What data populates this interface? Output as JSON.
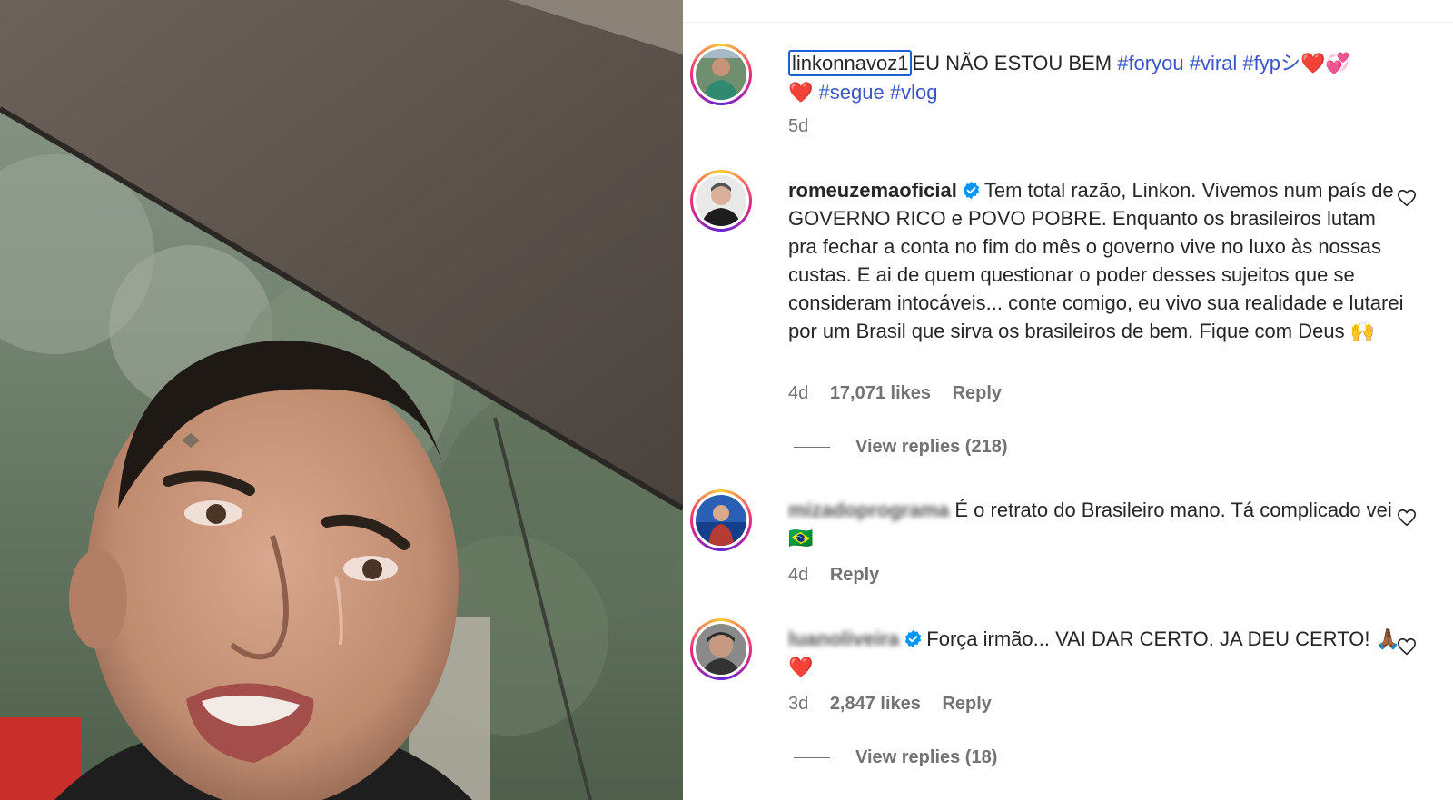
{
  "post": {
    "username": "linkonnavoz1",
    "caption": "EU NÃO ESTOU BEM",
    "hashtags_line1": [
      "#foryou",
      "#viral",
      "#fypシ"
    ],
    "emoji_line1": "❤️💞",
    "emoji_line2": "❤️",
    "hashtags_line2": [
      "#segue",
      "#vlog"
    ],
    "time": "5d"
  },
  "comments": [
    {
      "username": "romeuzemaoficial",
      "verified": true,
      "text": "Tem total razão, Linkon. Vivemos num país de GOVERNO RICO e POVO POBRE. Enquanto os brasileiros lutam pra fechar a conta no fim do mês o governo vive no luxo às nossas custas. E ai de quem questionar o poder desses sujeitos que se consideram intocáveis... conte comigo, eu vivo sua realidade e lutarei por um Brasil que sirva os brasileiros de bem. Fique com Deus 🙌",
      "time": "4d",
      "likes": "17,071 likes",
      "reply": "Reply",
      "view_replies": "View replies (218)"
    },
    {
      "username": "mizadoprograma",
      "verified": false,
      "text": "É o retrato do Brasileiro mano. Tá complicado vei",
      "text_blur_tail": "🇧🇷",
      "time": "4d",
      "reply": "Reply"
    },
    {
      "username": "luanoliveira",
      "verified": true,
      "text": "Força irmão... VAI DAR CERTO. JA DEU CERTO! 🙏🏾❤️",
      "time": "3d",
      "likes": "2,847 likes",
      "reply": "Reply",
      "view_replies": "View replies (18)"
    }
  ],
  "icons": {
    "like": "heart-icon",
    "verified": "verified-badge-icon"
  },
  "colors": {
    "hashtag": "#3a56c6",
    "meta": "#737373",
    "verified": "#0095f6",
    "focus_ring": "#1d5fd6"
  }
}
